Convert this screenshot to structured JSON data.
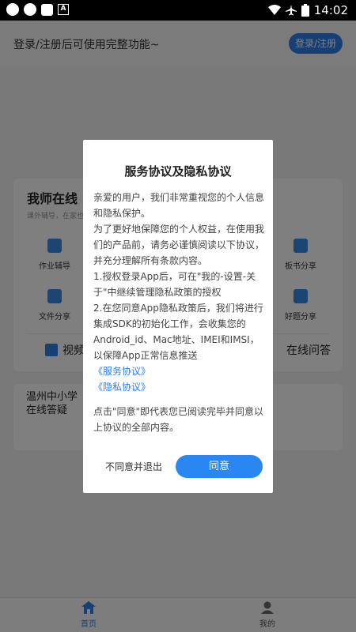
{
  "status_bar": {
    "time": "14:02",
    "a_icon_text": "A"
  },
  "header": {
    "login_hint": "登录/注册后可使用完整功能~",
    "login_button": "登录/注册"
  },
  "card_teacher": {
    "title": "我师在线",
    "subtitle": "课外辅导，在家也",
    "tools": [
      "作业辅导",
      "文件分享",
      "板书分享",
      "好题分享"
    ],
    "video_label": "视频",
    "qa_label": "在线问答"
  },
  "card_school": {
    "title": "温州中小学\n在线答疑"
  },
  "tabbar": {
    "home": "首页",
    "mine": "我的"
  },
  "dialog": {
    "title": "服务协议及隐私协议",
    "paragraphs": [
      "亲爱的用户，我们非常重视您的个人信息和隐私保护。",
      "为了更好地保障您的个人权益，在使用我们的产品前，请务必谨慎阅读以下协议，并充分理解所有条款内容。",
      "1.授权登录App后，可在\"我的-设置-关于\"中继续管理隐私政策的授权",
      "2.在您同意App隐私政策后，我们将进行集成SDK的初始化工作，会收集您的Android_id、Mac地址、IMEI和IMSI，以保障App正常信息推送"
    ],
    "links": [
      "《服务协议》",
      "《隐私协议》"
    ],
    "footer": "点击\"同意\"即代表您已阅读完毕并同意以上协议的全部内容。",
    "decline_button": "不同意并退出",
    "agree_button": "同意"
  },
  "colors": {
    "accent": "#2a86f0",
    "overlay": "rgba(0,0,0,0.5)"
  }
}
